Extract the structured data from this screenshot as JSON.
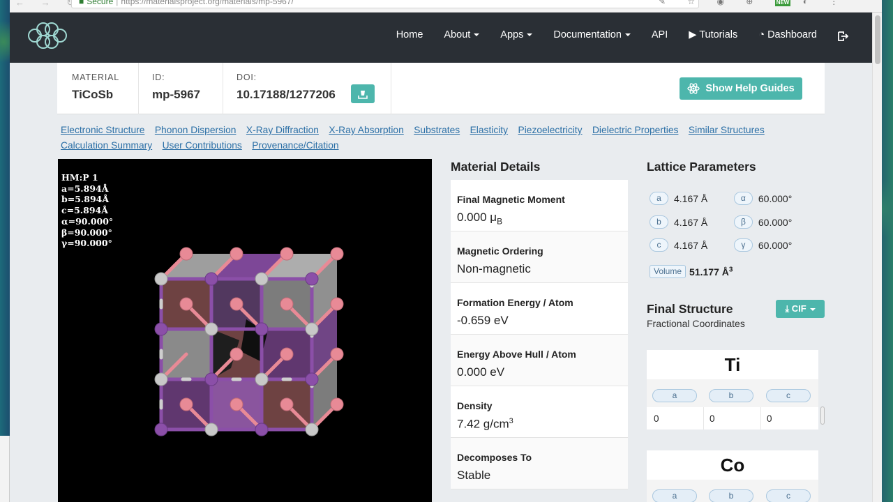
{
  "browser": {
    "security_label": "Secure",
    "url": "https://materialsproject.org/materials/mp-5967/",
    "ext_new_badge": "NEW"
  },
  "nav": {
    "items": [
      {
        "label": "Home"
      },
      {
        "label": "About",
        "dropdown": true
      },
      {
        "label": "Apps",
        "dropdown": true
      },
      {
        "label": "Documentation",
        "dropdown": true
      },
      {
        "label": "API"
      },
      {
        "label": "Tutorials",
        "icon": "video-icon"
      },
      {
        "label": "Dashboard",
        "icon": "dashboard-icon"
      }
    ]
  },
  "header": {
    "material_label": "MATERIAL",
    "material_value": "TiCoSb",
    "id_label": "ID:",
    "id_value": "mp-5967",
    "doi_label": "DOI:",
    "doi_value": "10.17188/1277206",
    "help_button": "Show Help Guides"
  },
  "section_links": [
    "Electronic Structure",
    "Phonon Dispersion",
    "X-Ray Diffraction",
    "X-Ray Absorption",
    "Substrates",
    "Elasticity",
    "Piezoelectricity",
    "Dielectric Properties",
    "Similar Structures",
    "Calculation Summary",
    "User Contributions",
    "Provenance/Citation"
  ],
  "viewer": {
    "info_lines": [
      "HM:P 1",
      "a=5.894Å",
      "b=5.894Å",
      "c=5.894Å",
      "α=90.000°",
      "β=90.000°",
      "γ=90.000°"
    ]
  },
  "material_details": {
    "title": "Material Details",
    "items": [
      {
        "key": "Final Magnetic Moment",
        "value": "0.000 μ",
        "sub": "B"
      },
      {
        "key": "Magnetic Ordering",
        "value": "Non-magnetic"
      },
      {
        "key": "Formation Energy / Atom",
        "value": "-0.659 eV"
      },
      {
        "key": "Energy Above Hull / Atom",
        "value": "0.000 eV"
      },
      {
        "key": "Density",
        "value": "7.42 g/cm",
        "sup": "3"
      },
      {
        "key": "Decomposes To",
        "value": "Stable"
      }
    ]
  },
  "lattice": {
    "title": "Lattice Parameters",
    "rows": [
      {
        "axis": "a",
        "length": "4.167 Å",
        "angle_label": "α",
        "angle": "60.000°"
      },
      {
        "axis": "b",
        "length": "4.167 Å",
        "angle_label": "β",
        "angle": "60.000°"
      },
      {
        "axis": "c",
        "length": "4.167 Å",
        "angle_label": "γ",
        "angle": "60.000°"
      }
    ],
    "volume_label": "Volume",
    "volume_value": "51.177 Å",
    "volume_sup": "3"
  },
  "final_structure": {
    "title": "Final Structure",
    "subtitle": "Fractional Coordinates",
    "cif_button": "CIF",
    "elements": [
      {
        "symbol": "Ti",
        "axes": [
          "a",
          "b",
          "c"
        ],
        "coords": [
          "0",
          "0",
          "0"
        ]
      },
      {
        "symbol": "Co",
        "axes": [
          "a",
          "b",
          "c"
        ],
        "coords": []
      }
    ]
  },
  "colors": {
    "navbar": "#2a2f35",
    "accent_teal": "#4db6ac",
    "link_blue": "#2b6fa6",
    "atom_pink": "#e88a96",
    "atom_purple": "#8b4fa8",
    "atom_grey": "#c8c8c8"
  }
}
